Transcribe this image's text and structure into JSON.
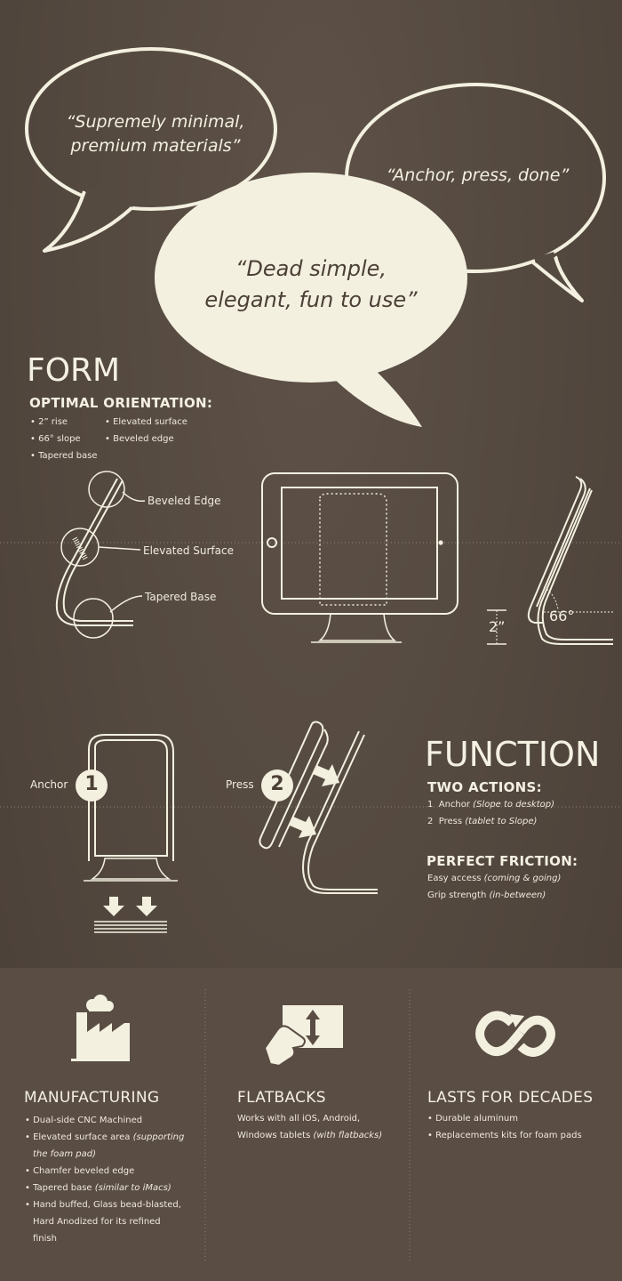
{
  "quotes": {
    "left_line1": "“Supremely minimal,",
    "left_line2": "premium materials”",
    "right": "“Anchor, press, done”",
    "center_line1": "“Dead simple,",
    "center_line2": "elegant, fun to use”"
  },
  "form": {
    "title": "FORM",
    "subtitle": "OPTIMAL ORIENTATION:",
    "col1": [
      "2” rise",
      "66° slope",
      "Tapered base"
    ],
    "col2": [
      "Elevated surface",
      "Beveled edge"
    ],
    "labels": {
      "beveled": "Beveled Edge",
      "elevated": "Elevated Surface",
      "tapered": "Tapered Base"
    },
    "dimension_rise": "2”",
    "dimension_angle": "66°"
  },
  "function": {
    "title": "FUNCTION",
    "anchor_label": "Anchor",
    "anchor_num": "1",
    "press_label": "Press",
    "press_num": "2",
    "two_actions_title": "TWO ACTIONS:",
    "action1_num": "1",
    "action1_text": "Anchor",
    "action1_note": "(Slope to desktop)",
    "action2_num": "2",
    "action2_text": "Press",
    "action2_note": "(tablet to Slope)",
    "friction_title": "PERFECT FRICTION:",
    "friction1_text": "Easy access",
    "friction1_note": "(coming & going)",
    "friction2_text": "Grip strength",
    "friction2_note": "(in-between)"
  },
  "manufacturing": {
    "title": "MANUFACTURING",
    "icon": "factory-icon",
    "item1": "Dual-side CNC Machined",
    "item2_text": "Elevated surface area",
    "item2_note_line1": "(supporting",
    "item2_note_line2": "the foam pad)",
    "item3": "Chamfer beveled edge",
    "item4_text": "Tapered base",
    "item4_note": "(similar to iMacs)",
    "item5_line1": "Hand buffed, Glass bead-blasted,",
    "item5_line2": "Hard Anodized for its refined",
    "item5_line3": "finish"
  },
  "flatbacks": {
    "title": "FLATBACKS",
    "icon": "hand-tablet-icon",
    "line1": "Works with all iOS, Android,",
    "line2_text": "Windows tablets",
    "line2_note": "(with flatbacks)"
  },
  "decades": {
    "title": "LASTS FOR DECADES",
    "icon": "infinity-loop-icon",
    "item1": "Durable aluminum",
    "item2": "Replacements kits for foam pads"
  },
  "colors": {
    "background": "#554a40",
    "bubble": "#f3f0e0",
    "text": "#f4f0e2",
    "bottom_band": "#5a4d43"
  }
}
